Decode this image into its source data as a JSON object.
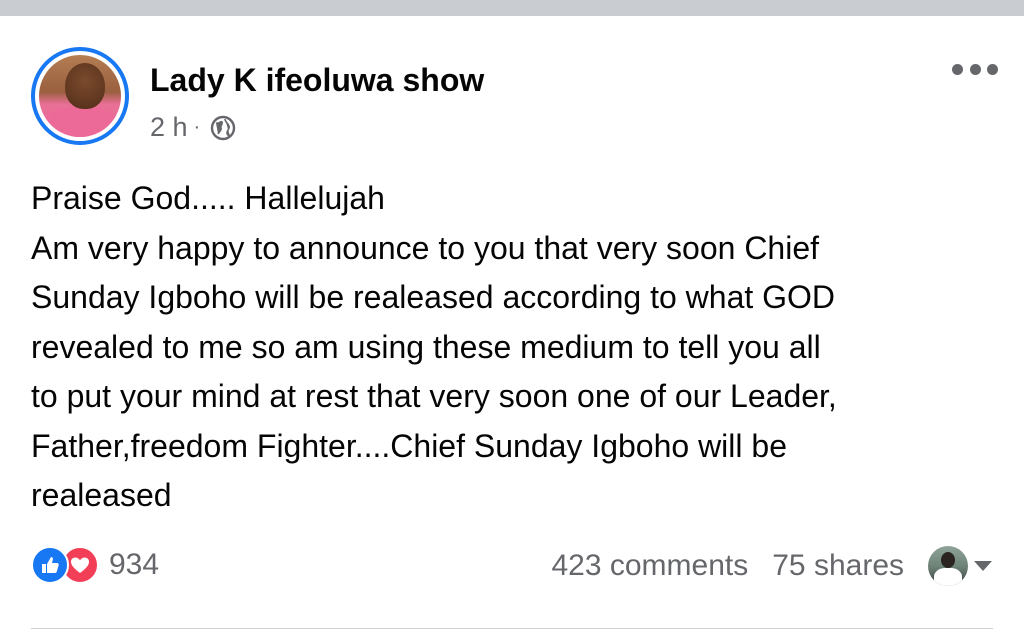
{
  "post": {
    "author": "Lady K ifeoluwa show",
    "time": "2 h",
    "separator": "·",
    "privacy_icon": "globe-icon",
    "more_icon": "more-options-icon",
    "lines": [
      "Praise God..... Hallelujah",
      "Am very happy to announce to you that very soon Chief",
      "Sunday Igboho will be realeased according to what GOD",
      "revealed to me so am using these medium to tell you all",
      "to put your mind at rest that very soon one of our Leader,",
      "Father,freedom Fighter....Chief Sunday Igboho will be",
      "realeased"
    ]
  },
  "footer": {
    "reaction_icons": [
      "like-reaction-icon",
      "love-reaction-icon"
    ],
    "reaction_count": "934",
    "comments": "423 comments",
    "shares": "75 shares",
    "viewer_avatar": "viewer-avatar",
    "dropdown_icon": "caret-down-icon"
  },
  "colors": {
    "brand_blue": "#1877f2",
    "love_red": "#f33e58",
    "secondary_text": "#65676b",
    "primary_text": "#050505"
  }
}
